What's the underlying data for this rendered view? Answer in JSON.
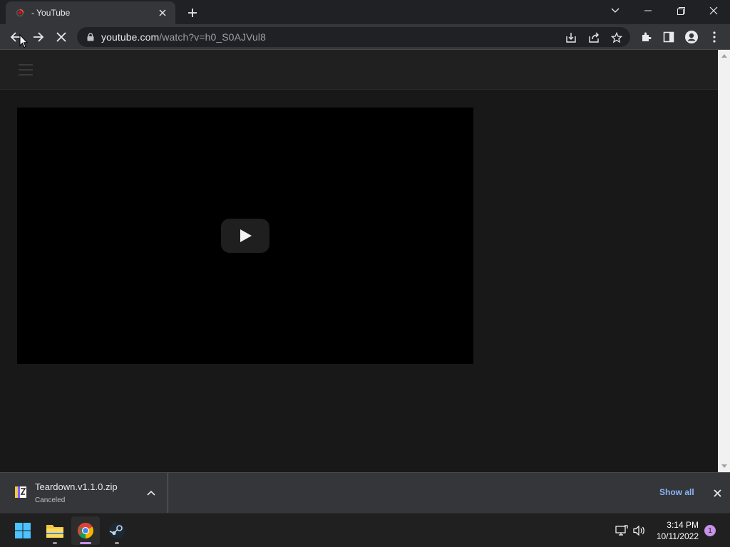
{
  "browser": {
    "tab": {
      "title": "- YouTube",
      "favicon": "youtube-loading-icon"
    },
    "address": {
      "host": "youtube.com",
      "path": "/watch?v=h0_S0AJVul8"
    },
    "toolbar_icons": [
      "back-icon",
      "forward-icon",
      "stop-icon",
      "lock-icon",
      "install-icon",
      "share-icon",
      "star-icon",
      "extensions-icon",
      "side-panel-icon",
      "profile-icon",
      "menu-icon"
    ]
  },
  "page": {
    "player": {
      "play_button": "play-icon"
    }
  },
  "downloads": {
    "filename": "Teardown.v1.1.0.zip",
    "status": "Canceled",
    "show_all": "Show all"
  },
  "taskbar": {
    "apps": [
      "windows-start-icon",
      "file-explorer-icon",
      "chrome-icon",
      "steam-icon"
    ],
    "time": "3:14 PM",
    "date": "10/11/2022",
    "notifications": "1"
  },
  "colors": {
    "accent_link": "#8ab4f8",
    "youtube_red": "#ff0000",
    "notification_badge": "#c792ea"
  }
}
